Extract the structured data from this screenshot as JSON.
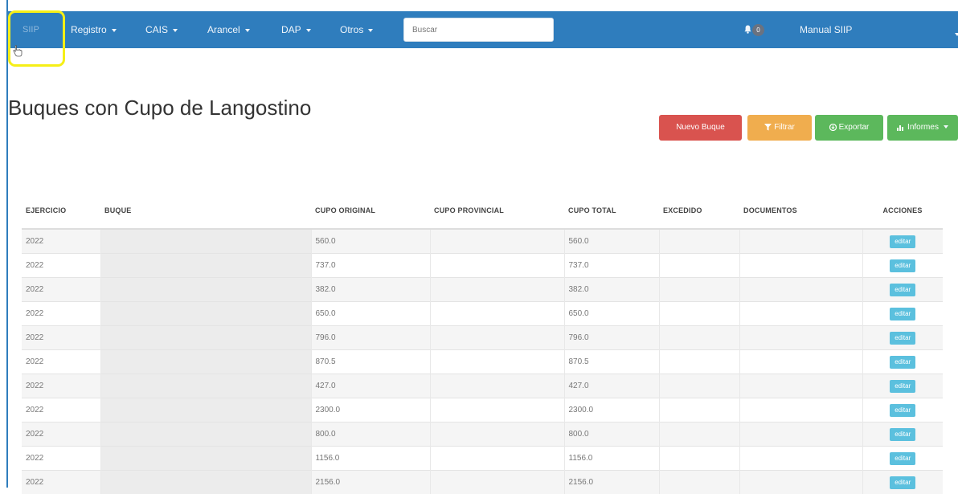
{
  "navbar": {
    "brand": "SIIP",
    "menus": [
      {
        "label": "Registro"
      },
      {
        "label": "CAIS"
      },
      {
        "label": "Arancel"
      },
      {
        "label": "DAP"
      },
      {
        "label": "Otros"
      }
    ],
    "search_placeholder": "Buscar",
    "notification_count": "0",
    "manual_link": "Manual SIIP",
    "accent_color": "#2f7dbd"
  },
  "page": {
    "title": "Buques con Cupo de Langostino"
  },
  "actions": {
    "new_label": "Nuevo Buque",
    "filter_label": "Filtrar",
    "export_label": "Exportar",
    "reports_label": "Informes"
  },
  "table": {
    "headers": [
      "EJERCICIO",
      "BUQUE",
      "CUPO ORIGINAL",
      "CUPO PROVINCIAL",
      "CUPO TOTAL",
      "EXCEDIDO",
      "DOCUMENTOS",
      "ACCIONES"
    ],
    "edit_label": "editar",
    "rows": [
      {
        "ejercicio": "2022",
        "cupo_original": "560.0",
        "cupo_total": "560.0"
      },
      {
        "ejercicio": "2022",
        "cupo_original": "737.0",
        "cupo_total": "737.0"
      },
      {
        "ejercicio": "2022",
        "cupo_original": "382.0",
        "cupo_total": "382.0"
      },
      {
        "ejercicio": "2022",
        "cupo_original": "650.0",
        "cupo_total": "650.0"
      },
      {
        "ejercicio": "2022",
        "cupo_original": "796.0",
        "cupo_total": "796.0"
      },
      {
        "ejercicio": "2022",
        "cupo_original": "870.5",
        "cupo_total": "870.5"
      },
      {
        "ejercicio": "2022",
        "cupo_original": "427.0",
        "cupo_total": "427.0"
      },
      {
        "ejercicio": "2022",
        "cupo_original": "2300.0",
        "cupo_total": "2300.0"
      },
      {
        "ejercicio": "2022",
        "cupo_original": "800.0",
        "cupo_total": "800.0"
      },
      {
        "ejercicio": "2022",
        "cupo_original": "1156.0",
        "cupo_total": "1156.0"
      },
      {
        "ejercicio": "2022",
        "cupo_original": "2156.0",
        "cupo_total": "2156.0"
      }
    ]
  },
  "highlight": {
    "color": "#f6ef17"
  }
}
